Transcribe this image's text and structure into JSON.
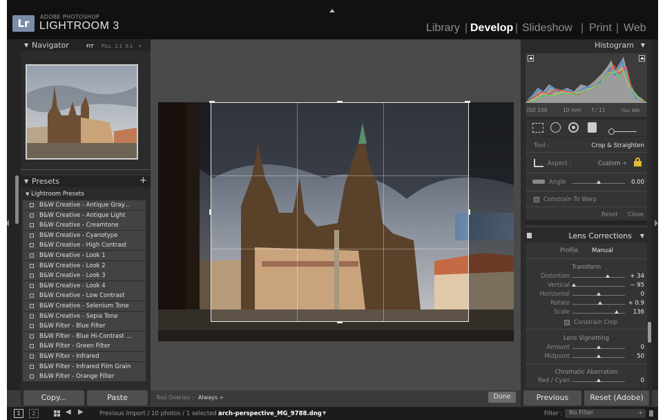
{
  "app": {
    "brand_top": "ADOBE PHOTOSHOP",
    "brand_main": "LIGHTROOM 3",
    "badge": "Lr"
  },
  "modules": [
    "Library",
    "Develop",
    "Slideshow",
    "Print",
    "Web"
  ],
  "navigator": {
    "title": "Navigator",
    "zoom_options": [
      "FIT",
      "FILL",
      "1:1",
      "3:1"
    ]
  },
  "presets": {
    "title": "Presets",
    "add": "+",
    "folder": "Lightroom Presets",
    "items": [
      "B&W Creative - Antique Gray...",
      "B&W Creative - Antique Light",
      "B&W Creative - Creamtone",
      "B&W Creative - Cyanotype",
      "B&W Creative - High Contrast",
      "B&W Creative - Look 1",
      "B&W Creative - Look 2",
      "B&W Creative - Look 3",
      "B&W Creative - Look 4",
      "B&W Creative - Low Contrast",
      "B&W Creative - Selenium Tone",
      "B&W Creative - Sepia Tone",
      "B&W Filter - Blue Filter",
      "B&W Filter - Blue Hi-Contrast ...",
      "B&W Filter - Green Filter",
      "B&W Filter - Infrared",
      "B&W Filter - Infrared Film Grain",
      "B&W Filter - Orange Filter"
    ]
  },
  "left_buttons": {
    "copy": "Copy...",
    "paste": "Paste"
  },
  "toolbar": {
    "overlay_label": "Tool Overlay :",
    "overlay_value": "Always ÷",
    "done": "Done"
  },
  "histogram": {
    "title": "Histogram",
    "iso": "ISO 100",
    "focal": "10 mm",
    "aperture": "f / 11",
    "shutter": "¹⁄₄₀₀ sec"
  },
  "crop": {
    "tool_label": "Tool :",
    "tool_value": "Crop & Straighten",
    "aspect_label": "Aspect :",
    "aspect_value": "Custom ÷",
    "angle_label": "Angle",
    "angle_value": "0.00",
    "angle_level": 0.5,
    "constrain": "Constrain To Warp",
    "reset": "Reset",
    "close": "Close"
  },
  "lens": {
    "title": "Lens Corrections",
    "tabs": [
      "Profile",
      "Manual"
    ],
    "transform_title": "Transform",
    "transform": [
      {
        "label": "Distortion",
        "value": "+ 34",
        "level": 0.67
      },
      {
        "label": "Vertical",
        "value": "− 95",
        "level": 0.03
      },
      {
        "label": "Horizontal",
        "value": "0",
        "level": 0.5
      },
      {
        "label": "Rotate",
        "value": "+ 0.9",
        "level": 0.52
      },
      {
        "label": "Scale",
        "value": "136",
        "level": 0.84
      }
    ],
    "constrain_crop": "Constrain Crop",
    "vignetting_title": "Lens Vignetting",
    "vignetting": [
      {
        "label": "Amount",
        "value": "0",
        "level": 0.5
      },
      {
        "label": "Midpoint",
        "value": "50",
        "level": 0.5
      }
    ],
    "ca_title": "Chromatic Aberration",
    "ca": [
      {
        "label": "Red / Cyan",
        "value": "0",
        "level": 0.5
      }
    ]
  },
  "right_buttons": {
    "previous": "Previous",
    "reset": "Reset (Adobe)"
  },
  "filmstrip": {
    "page1": "1",
    "page2": "2",
    "path": "Previous Import / 10 photos / 1 selected / ",
    "filename": "arch-perspective_MG_9788.dng",
    "filter_label": "Filter :",
    "filter_value": "No Filter"
  }
}
